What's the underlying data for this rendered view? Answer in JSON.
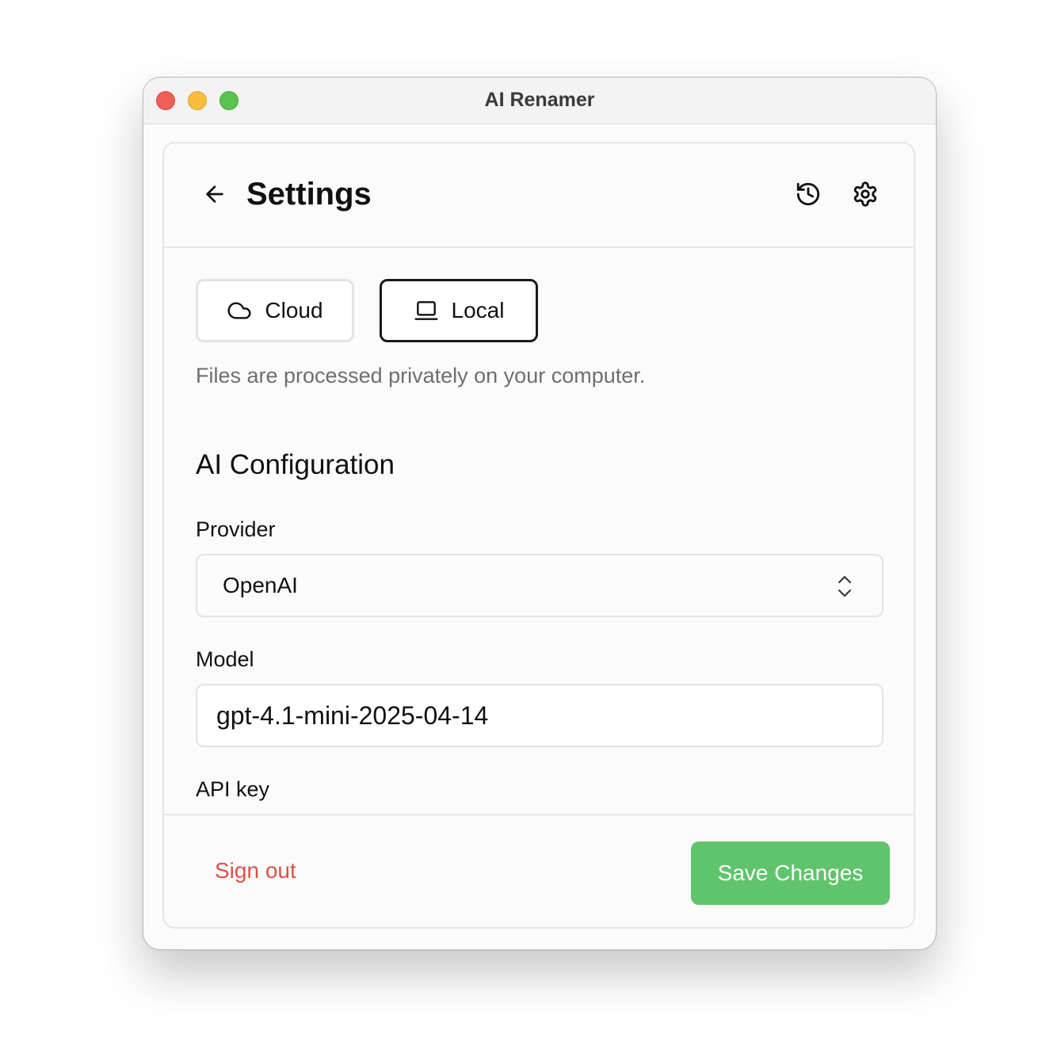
{
  "window": {
    "title": "AI Renamer"
  },
  "header": {
    "title": "Settings",
    "icons": [
      "arrow-left-icon",
      "history-icon",
      "gear-icon"
    ]
  },
  "mode": {
    "options": [
      {
        "label": "Cloud",
        "icon": "cloud-icon",
        "selected": false
      },
      {
        "label": "Local",
        "icon": "laptop-icon",
        "selected": true
      }
    ],
    "description": "Files are processed privately on your computer."
  },
  "ai_config": {
    "title": "AI Configuration",
    "provider_label": "Provider",
    "provider_value": "OpenAI",
    "model_label": "Model",
    "model_value": "gpt-4.1-mini-2025-04-14",
    "api_key_label": "API key"
  },
  "footer": {
    "sign_out_label": "Sign out",
    "save_label": "Save Changes"
  },
  "colors": {
    "accent_green": "#5fc46b",
    "danger_red": "#dd5147",
    "traffic_close": "#ee5f58",
    "traffic_minimize": "#f8bd3c",
    "traffic_maximize": "#5ac24f"
  }
}
